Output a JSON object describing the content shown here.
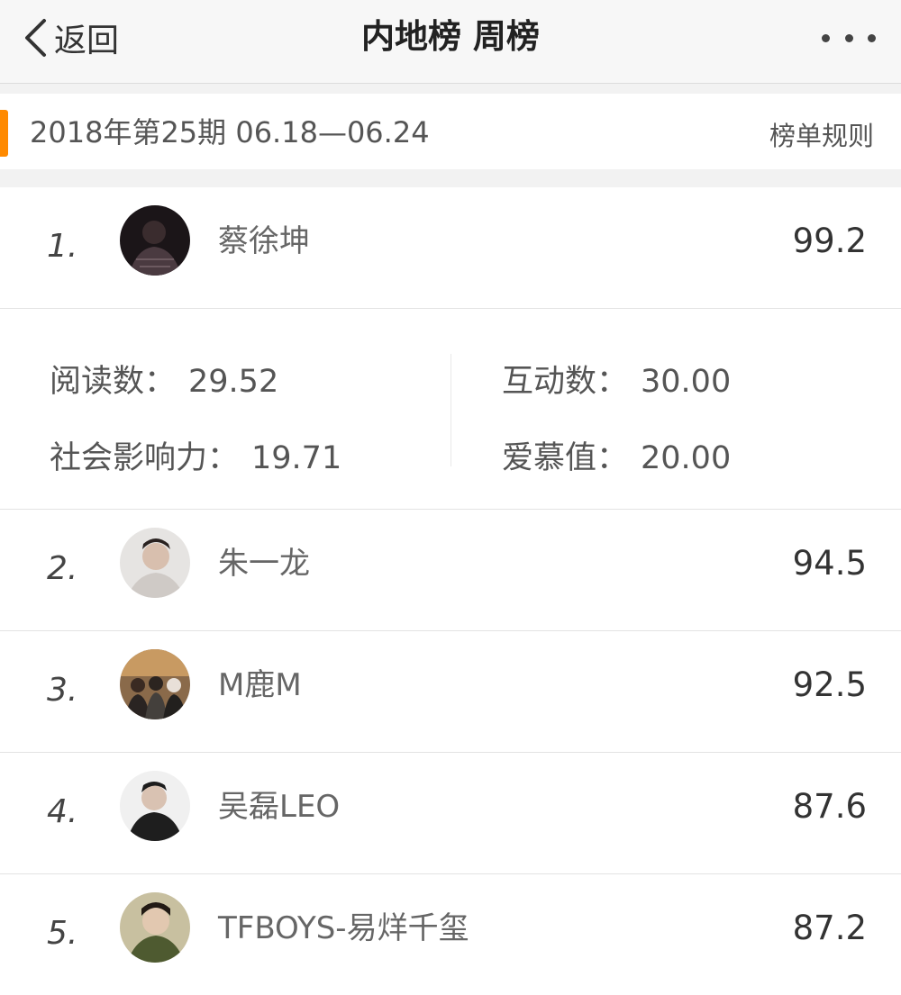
{
  "navbar": {
    "back_label": "返回",
    "title": "内地榜 周榜",
    "more_icon": "more-dots-icon"
  },
  "period": {
    "text": "2018年第25期  06.18—06.24",
    "rules_label": "榜单规则",
    "accent_color": "#ff8a00"
  },
  "ranking": [
    {
      "rank": "1.",
      "name": "蔡徐坤",
      "score": "99.2"
    },
    {
      "rank": "2.",
      "name": "朱一龙",
      "score": "94.5"
    },
    {
      "rank": "3.",
      "name": "M鹿M",
      "score": "92.5"
    },
    {
      "rank": "4.",
      "name": "吴磊LEO",
      "score": "87.6"
    },
    {
      "rank": "5.",
      "name": "TFBOYS-易烊千玺",
      "score": "87.2"
    }
  ],
  "details": {
    "reads_label": "阅读数：",
    "reads_value": "29.52",
    "interactions_label": "互动数：",
    "interactions_value": "30.00",
    "social_label": "社会影响力：",
    "social_value": "19.71",
    "love_label": "爱慕值：",
    "love_value": "20.00"
  }
}
